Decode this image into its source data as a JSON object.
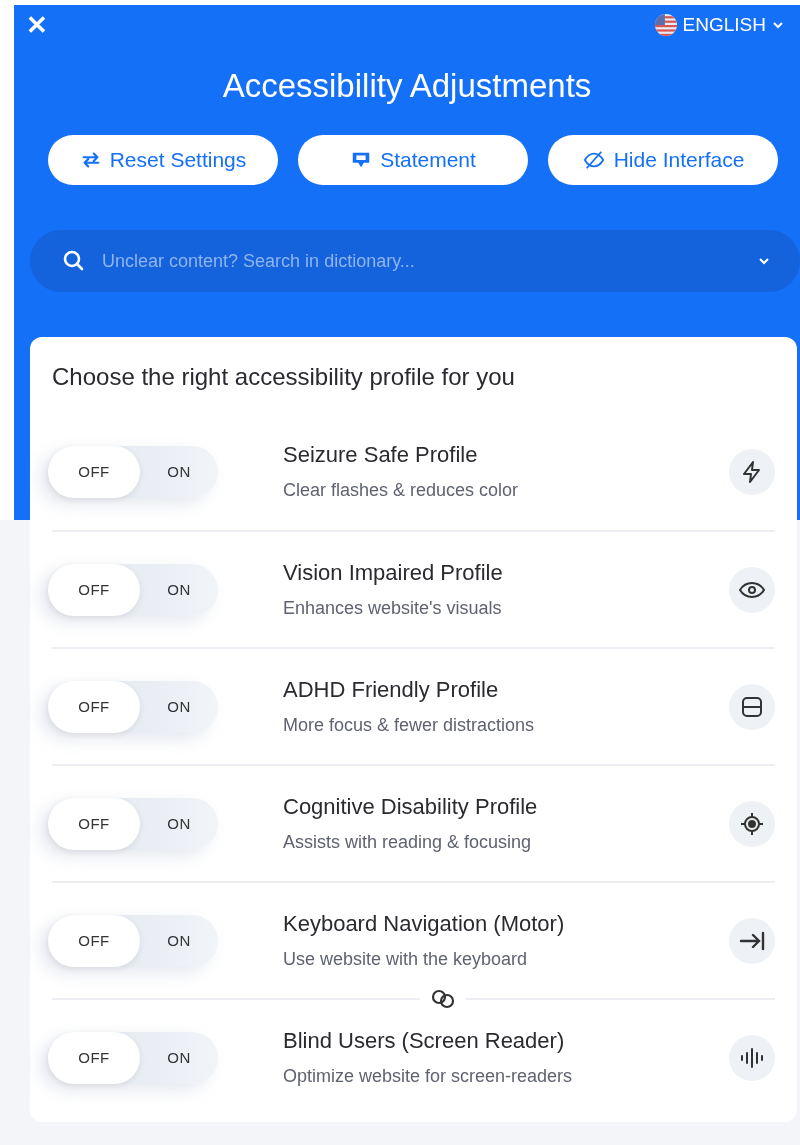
{
  "header": {
    "close": "✕",
    "language": "ENGLISH",
    "title": "Accessibility Adjustments",
    "buttons": [
      {
        "kind": "reset",
        "label": "Reset Settings"
      },
      {
        "kind": "statement",
        "label": "Statement"
      },
      {
        "kind": "hide",
        "label": "Hide Interface"
      }
    ],
    "search": {
      "placeholder": "Unclear content? Search in dictionary..."
    }
  },
  "profiles": {
    "heading": "Choose the right accessibility profile for you",
    "items": [
      {
        "title": "Seizure Safe Profile",
        "description": "Clear flashes & reduces color",
        "off_label": "OFF",
        "on_label": "ON",
        "on": false,
        "kind": "bolt"
      },
      {
        "title": "Vision Impaired Profile",
        "description": "Enhances website's visuals",
        "off_label": "OFF",
        "on_label": "ON",
        "on": false,
        "kind": "eye"
      },
      {
        "title": "ADHD Friendly Profile",
        "description": "More focus & fewer distractions",
        "off_label": "OFF",
        "on_label": "ON",
        "on": false,
        "kind": "focus"
      },
      {
        "title": "Cognitive Disability Profile",
        "description": "Assists with reading & focusing",
        "off_label": "OFF",
        "on_label": "ON",
        "on": false,
        "kind": "target"
      },
      {
        "title": "Keyboard Navigation (Motor)",
        "description": "Use website with the keyboard",
        "off_label": "OFF",
        "on_label": "ON",
        "on": false,
        "kind": "tab"
      },
      {
        "title": "Blind Users (Screen Reader)",
        "description": "Optimize website for screen-readers",
        "off_label": "OFF",
        "on_label": "ON",
        "on": false,
        "kind": "audio"
      }
    ]
  }
}
